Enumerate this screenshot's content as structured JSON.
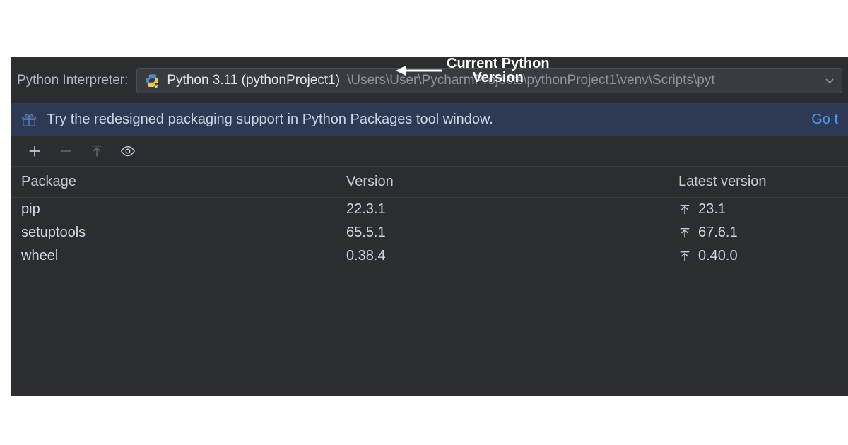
{
  "interpreter": {
    "label": "Python Interpreter:",
    "selected_name": "Python 3.11 (pythonProject1)",
    "selected_path": "\\Users\\User\\PycharmProjects\\pythonProject1\\venv\\Scripts\\pyt"
  },
  "promo": {
    "text": "Try the redesigned packaging support in Python Packages tool window.",
    "link": "Go t"
  },
  "columns": {
    "package": "Package",
    "version": "Version",
    "latest": "Latest version"
  },
  "packages": [
    {
      "name": "pip",
      "version": "22.3.1",
      "latest": "23.1",
      "upgrade": true
    },
    {
      "name": "setuptools",
      "version": "65.5.1",
      "latest": "67.6.1",
      "upgrade": true
    },
    {
      "name": "wheel",
      "version": "0.38.4",
      "latest": "0.40.0",
      "upgrade": true
    }
  ],
  "annotation": {
    "line1": "Current Python",
    "line2": "Version"
  }
}
